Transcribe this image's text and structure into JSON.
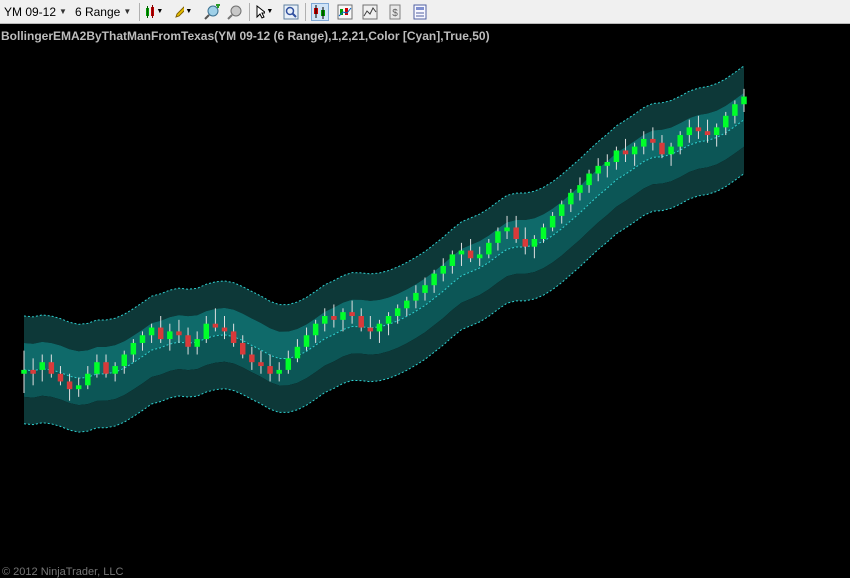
{
  "toolbar": {
    "instrument": "YM 09-12",
    "interval": "6 Range"
  },
  "indicator_label": "BollingerEMA2ByThatManFromTexas(YM 09-12 (6 Range),1,2,21,Color [Cyan],True,50)",
  "copyright": "© 2012 NinjaTrader, LLC",
  "icons": [
    "chart-style-icon",
    "pencil-icon",
    "zoom-in-icon",
    "zoom-out-icon",
    "cursor-icon",
    "magnifier-icon",
    "data-series-icon",
    "indicators-icon",
    "strategies-icon",
    "properties-icon",
    "chart-trader-icon"
  ],
  "colors": {
    "background": "#000000",
    "up_candle": "#00ff2a",
    "down_candle": "#d83a3a",
    "band_outer": "#0d3838",
    "band_inner": "#0f6a6a",
    "band_middle": "#0c5656",
    "line": "#2fd0d0"
  },
  "chart_data": {
    "type": "candlestick",
    "bar_count": 84,
    "price_range": [
      0,
      100
    ],
    "candles": [
      {
        "o": 25,
        "h": 31,
        "l": 20,
        "c": 26
      },
      {
        "o": 26,
        "h": 29,
        "l": 22,
        "c": 25
      },
      {
        "o": 26,
        "h": 30,
        "l": 23,
        "c": 28
      },
      {
        "o": 28,
        "h": 30,
        "l": 24,
        "c": 25
      },
      {
        "o": 25,
        "h": 27,
        "l": 22,
        "c": 23
      },
      {
        "o": 23,
        "h": 25,
        "l": 18,
        "c": 21
      },
      {
        "o": 21,
        "h": 24,
        "l": 19,
        "c": 22
      },
      {
        "o": 22,
        "h": 27,
        "l": 21,
        "c": 25
      },
      {
        "o": 25,
        "h": 30,
        "l": 24,
        "c": 28
      },
      {
        "o": 28,
        "h": 30,
        "l": 24,
        "c": 25
      },
      {
        "o": 25,
        "h": 28,
        "l": 23,
        "c": 27
      },
      {
        "o": 27,
        "h": 31,
        "l": 25,
        "c": 30
      },
      {
        "o": 30,
        "h": 34,
        "l": 28,
        "c": 33
      },
      {
        "o": 33,
        "h": 36,
        "l": 31,
        "c": 35
      },
      {
        "o": 35,
        "h": 38,
        "l": 33,
        "c": 37
      },
      {
        "o": 37,
        "h": 40,
        "l": 33,
        "c": 34
      },
      {
        "o": 34,
        "h": 38,
        "l": 31,
        "c": 36
      },
      {
        "o": 36,
        "h": 39,
        "l": 33,
        "c": 35
      },
      {
        "o": 35,
        "h": 37,
        "l": 30,
        "c": 32
      },
      {
        "o": 32,
        "h": 36,
        "l": 30,
        "c": 34
      },
      {
        "o": 34,
        "h": 40,
        "l": 33,
        "c": 38
      },
      {
        "o": 38,
        "h": 42,
        "l": 36,
        "c": 37
      },
      {
        "o": 37,
        "h": 40,
        "l": 34,
        "c": 36
      },
      {
        "o": 36,
        "h": 38,
        "l": 32,
        "c": 33
      },
      {
        "o": 33,
        "h": 35,
        "l": 29,
        "c": 30
      },
      {
        "o": 30,
        "h": 32,
        "l": 26,
        "c": 28
      },
      {
        "o": 28,
        "h": 31,
        "l": 25,
        "c": 27
      },
      {
        "o": 27,
        "h": 30,
        "l": 23,
        "c": 25
      },
      {
        "o": 25,
        "h": 28,
        "l": 23,
        "c": 26
      },
      {
        "o": 26,
        "h": 31,
        "l": 25,
        "c": 29
      },
      {
        "o": 29,
        "h": 34,
        "l": 28,
        "c": 32
      },
      {
        "o": 32,
        "h": 37,
        "l": 31,
        "c": 35
      },
      {
        "o": 35,
        "h": 39,
        "l": 33,
        "c": 38
      },
      {
        "o": 38,
        "h": 42,
        "l": 36,
        "c": 40
      },
      {
        "o": 40,
        "h": 43,
        "l": 37,
        "c": 39
      },
      {
        "o": 39,
        "h": 42,
        "l": 36,
        "c": 41
      },
      {
        "o": 41,
        "h": 44,
        "l": 38,
        "c": 40
      },
      {
        "o": 40,
        "h": 42,
        "l": 36,
        "c": 37
      },
      {
        "o": 37,
        "h": 40,
        "l": 34,
        "c": 36
      },
      {
        "o": 36,
        "h": 39,
        "l": 33,
        "c": 38
      },
      {
        "o": 38,
        "h": 41,
        "l": 35,
        "c": 40
      },
      {
        "o": 40,
        "h": 43,
        "l": 38,
        "c": 42
      },
      {
        "o": 42,
        "h": 45,
        "l": 40,
        "c": 44
      },
      {
        "o": 44,
        "h": 48,
        "l": 42,
        "c": 46
      },
      {
        "o": 46,
        "h": 50,
        "l": 44,
        "c": 48
      },
      {
        "o": 48,
        "h": 52,
        "l": 46,
        "c": 51
      },
      {
        "o": 51,
        "h": 55,
        "l": 49,
        "c": 53
      },
      {
        "o": 53,
        "h": 57,
        "l": 51,
        "c": 56
      },
      {
        "o": 56,
        "h": 59,
        "l": 53,
        "c": 57
      },
      {
        "o": 57,
        "h": 60,
        "l": 54,
        "c": 55
      },
      {
        "o": 55,
        "h": 58,
        "l": 53,
        "c": 56
      },
      {
        "o": 56,
        "h": 60,
        "l": 55,
        "c": 59
      },
      {
        "o": 59,
        "h": 63,
        "l": 57,
        "c": 62
      },
      {
        "o": 62,
        "h": 66,
        "l": 60,
        "c": 63
      },
      {
        "o": 63,
        "h": 66,
        "l": 59,
        "c": 60
      },
      {
        "o": 60,
        "h": 63,
        "l": 56,
        "c": 58
      },
      {
        "o": 58,
        "h": 61,
        "l": 55,
        "c": 60
      },
      {
        "o": 60,
        "h": 64,
        "l": 59,
        "c": 63
      },
      {
        "o": 63,
        "h": 67,
        "l": 62,
        "c": 66
      },
      {
        "o": 66,
        "h": 70,
        "l": 64,
        "c": 69
      },
      {
        "o": 69,
        "h": 73,
        "l": 67,
        "c": 72
      },
      {
        "o": 72,
        "h": 76,
        "l": 70,
        "c": 74
      },
      {
        "o": 74,
        "h": 78,
        "l": 72,
        "c": 77
      },
      {
        "o": 77,
        "h": 81,
        "l": 75,
        "c": 79
      },
      {
        "o": 79,
        "h": 82,
        "l": 76,
        "c": 80
      },
      {
        "o": 80,
        "h": 84,
        "l": 78,
        "c": 83
      },
      {
        "o": 83,
        "h": 86,
        "l": 80,
        "c": 82
      },
      {
        "o": 82,
        "h": 85,
        "l": 79,
        "c": 84
      },
      {
        "o": 84,
        "h": 88,
        "l": 82,
        "c": 86
      },
      {
        "o": 86,
        "h": 89,
        "l": 83,
        "c": 85
      },
      {
        "o": 85,
        "h": 87,
        "l": 81,
        "c": 82
      },
      {
        "o": 82,
        "h": 85,
        "l": 79,
        "c": 84
      },
      {
        "o": 84,
        "h": 88,
        "l": 82,
        "c": 87
      },
      {
        "o": 87,
        "h": 91,
        "l": 85,
        "c": 89
      },
      {
        "o": 89,
        "h": 92,
        "l": 86,
        "c": 88
      },
      {
        "o": 88,
        "h": 91,
        "l": 85,
        "c": 87
      },
      {
        "o": 87,
        "h": 90,
        "l": 84,
        "c": 89
      },
      {
        "o": 89,
        "h": 93,
        "l": 87,
        "c": 92
      },
      {
        "o": 92,
        "h": 96,
        "l": 90,
        "c": 95
      },
      {
        "o": 95,
        "h": 99,
        "l": 93,
        "c": 97
      }
    ]
  }
}
